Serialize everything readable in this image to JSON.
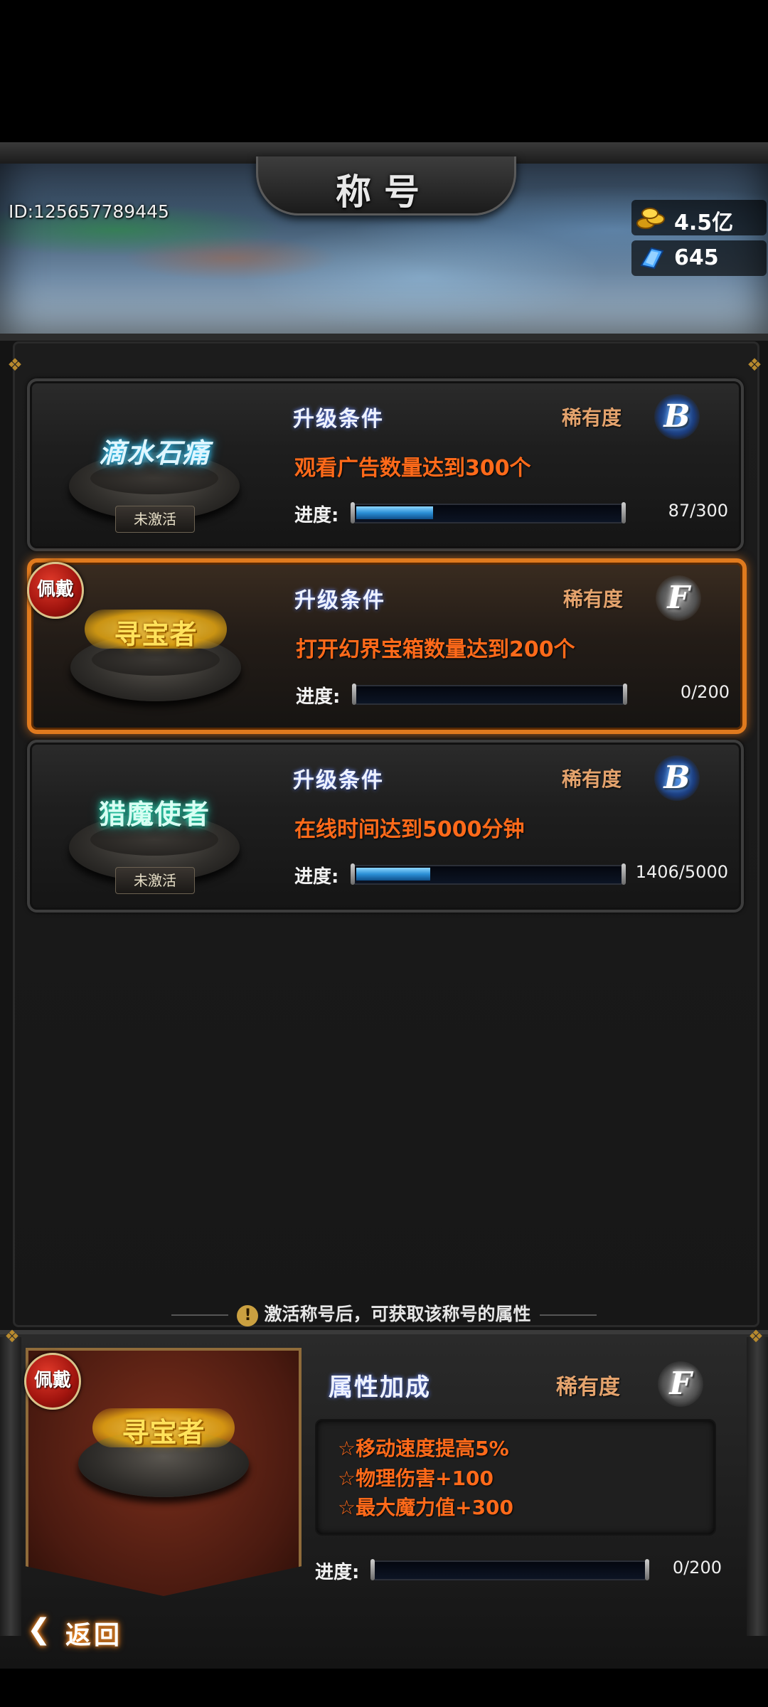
{
  "header": {
    "title": "称号",
    "user_id": "ID:125657789445",
    "gold": {
      "icon": "gold-coins-icon",
      "value": "4.5亿"
    },
    "gems": {
      "icon": "blue-crystal-icon",
      "value": "645"
    }
  },
  "titles": [
    {
      "badge_name": "滴水石痛",
      "status": "未激活",
      "equipped": false,
      "condition_header": "升级条件",
      "rarity_label": "稀有度",
      "rarity": "B",
      "condition": "观看广告数量达到300个",
      "progress_label": "进度:",
      "progress_text": "87/300",
      "progress_value": 87,
      "progress_max": 300
    },
    {
      "badge_name": "寻宝者",
      "status": "",
      "equipped": true,
      "equipped_label": "佩戴",
      "condition_header": "升级条件",
      "rarity_label": "稀有度",
      "rarity": "F",
      "condition": "打开幻界宝箱数量达到200个",
      "progress_label": "进度:",
      "progress_text": "0/200",
      "progress_value": 0,
      "progress_max": 200
    },
    {
      "badge_name": "猎魔使者",
      "status": "未激活",
      "equipped": false,
      "condition_header": "升级条件",
      "rarity_label": "稀有度",
      "rarity": "B",
      "condition": "在线时间达到5000分钟",
      "progress_label": "进度:",
      "progress_text": "1406/5000",
      "progress_value": 1406,
      "progress_max": 5000
    }
  ],
  "info_bar": {
    "icon": "exclamation-icon",
    "text": "激活称号后，可获取该称号的属性"
  },
  "detail": {
    "equipped_label": "佩戴",
    "badge_name": "寻宝者",
    "attr_header": "属性加成",
    "rarity_label": "稀有度",
    "rarity": "F",
    "attributes": [
      "☆移动速度提高5%",
      "☆物理伤害+100",
      "☆最大魔力值+300"
    ],
    "progress_label": "进度:",
    "progress_text": "0/200",
    "progress_value": 0,
    "progress_max": 200
  },
  "back_button": {
    "label": "返回",
    "icon": "back-arrow-icon"
  },
  "colors": {
    "accent_orange": "#ff6a1a",
    "equipped_border": "#e07a1e",
    "rarity_label": "#e4a36d",
    "progress_fill": "#2a8fd6"
  }
}
